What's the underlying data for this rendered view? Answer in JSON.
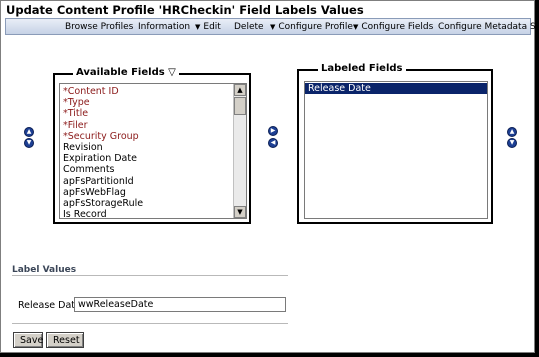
{
  "title": "Update Content Profile 'HRCheckin' Field Labels Values",
  "menu": {
    "browse_profiles": "Browse Profiles",
    "information": "Information",
    "edit": "Edit",
    "delete": "Delete",
    "configure_profile": "Configure Profile",
    "configure_fields": "Configure Fields",
    "configure_metadata_set": "Configure Metadata Set"
  },
  "available": {
    "legend": "Available Fields",
    "items": [
      "*Content ID",
      "*Type",
      "*Title",
      "*Filer",
      "*Security Group",
      "Revision",
      "Expiration Date",
      "Comments",
      "apFsPartitionId",
      "apFsWebFlag",
      "apFsStorageRule",
      "Is Record"
    ]
  },
  "labeled": {
    "legend": "Labeled Fields",
    "items": [
      "Release Date"
    ]
  },
  "label_values": {
    "heading": "Label Values",
    "field_label": "Release Date",
    "field_value": "wwReleaseDate"
  },
  "buttons": {
    "save": "Save",
    "reset": "Reset"
  },
  "colors": {
    "menubar": "#c6d2e6",
    "required_field": "#8b1a1a",
    "selection": "#0a246a",
    "nav_button": "#1d3f94"
  }
}
